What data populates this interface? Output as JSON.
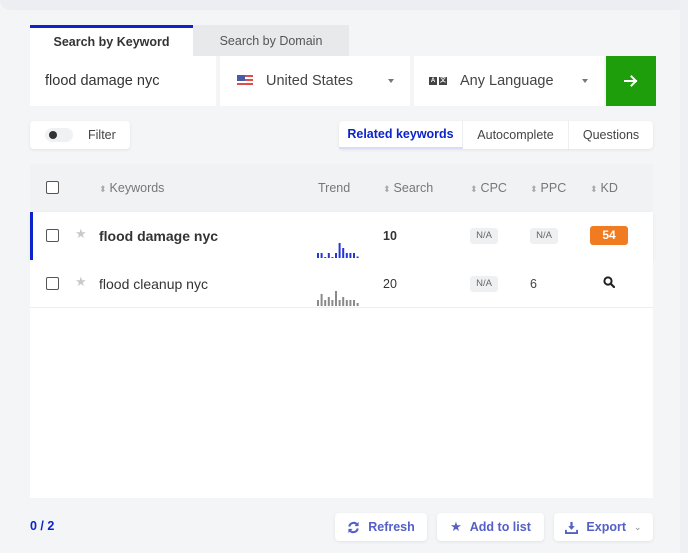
{
  "tabs": [
    {
      "label": "Search by Keyword",
      "active": true
    },
    {
      "label": "Search by Domain",
      "active": false
    }
  ],
  "search": {
    "keyword_value": "flood damage nyc",
    "country": {
      "label": "United States",
      "icon": "us-flag-icon"
    },
    "language": {
      "label": "Any Language",
      "icon": "translate-icon"
    },
    "submit_icon": "arrow-right-icon"
  },
  "filter": {
    "label": "Filter",
    "enabled": false
  },
  "modes": [
    {
      "label": "Related keywords",
      "active": true
    },
    {
      "label": "Autocomplete",
      "active": false
    },
    {
      "label": "Questions",
      "active": false
    }
  ],
  "table": {
    "columns": {
      "keywords": "Keywords",
      "trend": "Trend",
      "search": "Search",
      "cpc": "CPC",
      "ppc": "PPC",
      "kd": "KD"
    },
    "rows": [
      {
        "keyword": "flood damage nyc",
        "trend": [
          1,
          1,
          0,
          1,
          0,
          1,
          3,
          2,
          1,
          1,
          1,
          0.3
        ],
        "search": "10",
        "cpc": "N/A",
        "ppc": "N/A",
        "kd": "54",
        "highlighted": true
      },
      {
        "keyword": "flood cleanup nyc",
        "trend": [
          2,
          4,
          2,
          3,
          2,
          5,
          2,
          3,
          2,
          2,
          2,
          1
        ],
        "search": "20",
        "cpc": "N/A",
        "ppc": "6",
        "kd_icon": "search-icon",
        "highlighted": false
      }
    ]
  },
  "footer": {
    "selection_count": "0 / 2",
    "refresh_label": "Refresh",
    "add_to_list_label": "Add to list",
    "export_label": "Export"
  },
  "colors": {
    "accent_blue": "#0c24c9",
    "go_green": "#1f9e0c",
    "kd_orange": "#f07b20",
    "button_text": "#5460c6",
    "trend_row1": "#2336d6",
    "trend_row2": "#8a8a8a"
  }
}
